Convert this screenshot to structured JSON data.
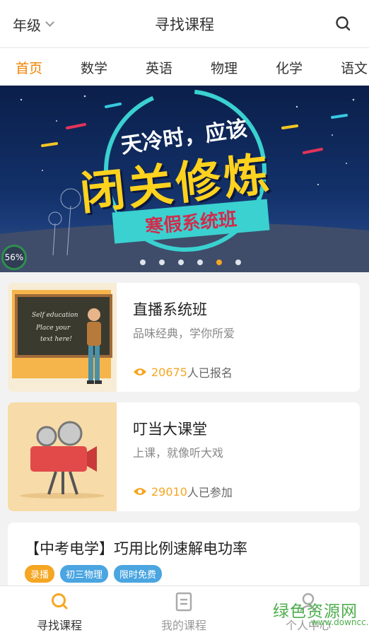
{
  "header": {
    "grade_label": "年级",
    "title": "寻找课程"
  },
  "tabs": [
    "首页",
    "数学",
    "英语",
    "物理",
    "化学",
    "语文"
  ],
  "banner": {
    "line1": "天冷时，应该",
    "line2": "闭关修炼",
    "ribbon": "寒假系统班",
    "progress_text": "56%",
    "progress_fraction": 0.56,
    "dots_count": 6,
    "active_dot": 4
  },
  "cards": [
    {
      "title": "直播系统班",
      "subtitle": "品味经典，学你所爱",
      "count": "20675",
      "count_suffix": "人已报名",
      "board_text": [
        "Self education",
        "Place your",
        "text here!"
      ]
    },
    {
      "title": "叮当大课堂",
      "subtitle": "上课，就像听大戏",
      "count": "29010",
      "count_suffix": "人已参加"
    }
  ],
  "course": {
    "title": "【中考电学】巧用比例速解电功率",
    "tags": [
      "录播",
      "初三物理",
      "限时免费"
    ]
  },
  "bottom_nav": [
    {
      "label": "寻找课程"
    },
    {
      "label": "我的课程"
    },
    {
      "label": "个人中心"
    }
  ],
  "watermark": {
    "text": "绿色资源网",
    "sub": "www.downcc.com"
  },
  "colors": {
    "accent": "#f08300",
    "count": "#f5a623",
    "tag_blue": "#4aa5e0",
    "banner_ring": "#3ad1d0"
  }
}
